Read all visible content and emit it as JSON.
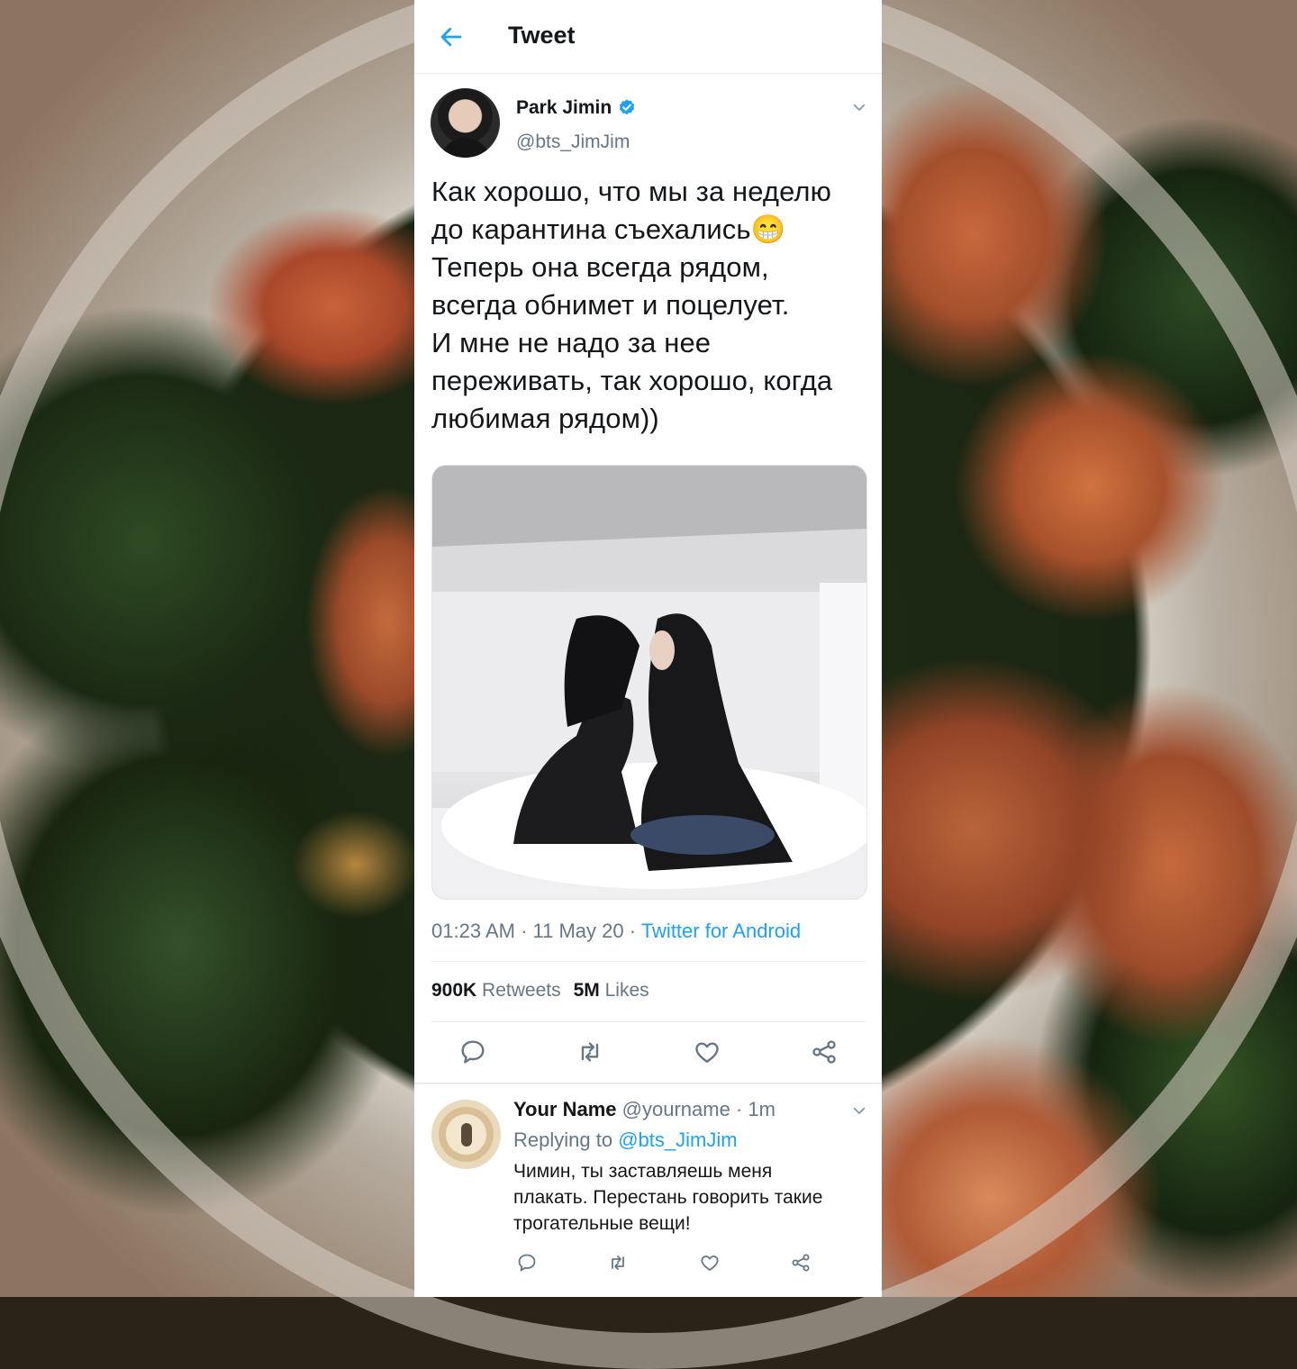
{
  "header": {
    "title": "Tweet"
  },
  "tweet": {
    "author_name": "Park Jimin",
    "author_handle": "@bts_JimJim",
    "text": "Как хорошо, что мы за неделю\nдо карантина съехались😁\nТеперь она всегда рядом,\nвсегда обнимет и поцелует.\nИ мне не надо за нее\nпереживать, так хорошо, когда\nлюбимая рядом))",
    "time": "01:23 AM",
    "date": "11 May 20",
    "client": "Twitter for Android",
    "retweets_count": "900K",
    "retweets_label": "Retweets",
    "likes_count": "5M",
    "likes_label": "Likes"
  },
  "reply": {
    "name": "Your Name",
    "handle": "@yourname",
    "age": "1m",
    "replying_label": "Replying to",
    "replying_to": "@bts_JimJim",
    "text": "Чимин, ты заставляешь меня\nплакать. Перестань говорить такие\nтрогательные вещи!"
  },
  "colors": {
    "accent": "#1da1f2",
    "text": "#14171a",
    "muted": "#657786",
    "icon": "#657786"
  },
  "icons": [
    "back-arrow-icon",
    "verified-icon",
    "chevron-down-icon",
    "reply-icon",
    "retweet-icon",
    "like-icon",
    "share-icon"
  ]
}
